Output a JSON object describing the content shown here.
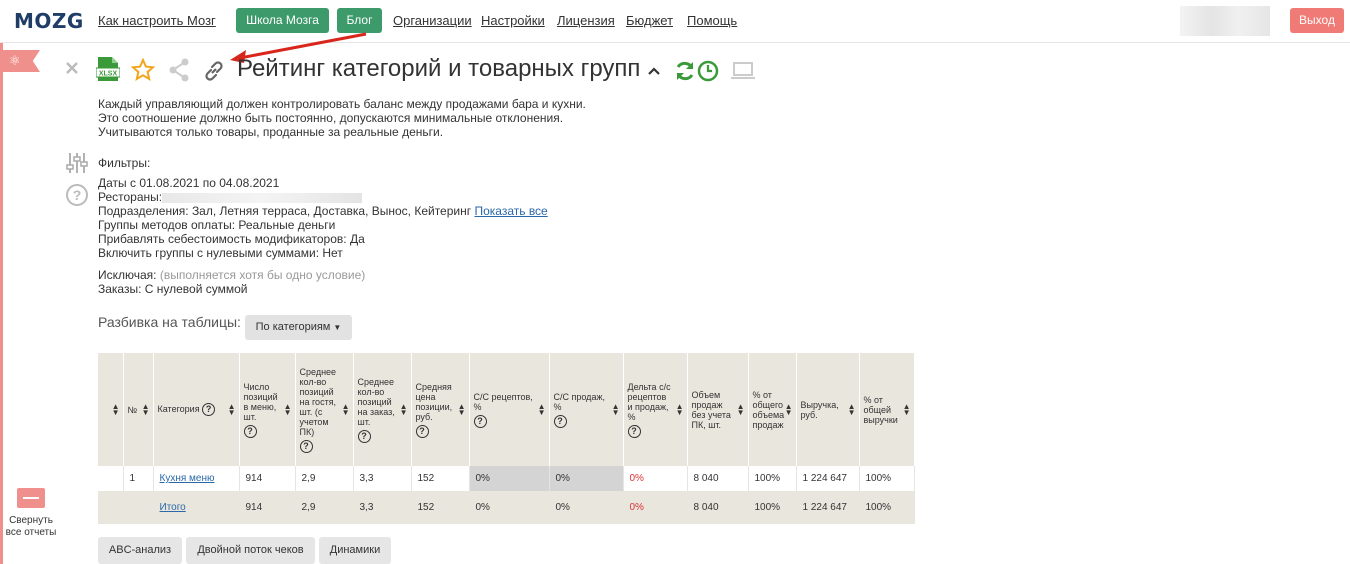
{
  "nav": {
    "logo": "MOZG",
    "how_to": "Как настроить Мозг",
    "school": "Школа Мозга",
    "blog": "Блог",
    "orgs": "Организации",
    "settings": "Настройки",
    "license": "Лицензия",
    "budget": "Бюджет",
    "help": "Помощь",
    "logout": "Выход"
  },
  "sidebar": {
    "collapse_label": "Свернуть все отчеты"
  },
  "report": {
    "title": "Рейтинг категорий и товарных групп",
    "description": [
      "Каждый управляющий должен контролировать баланс между продажами бара и кухни.",
      "Это соотношение должно быть постоянно, допускаются минимальные отклонения.",
      "Учитываются только товары, проданные за реальные деньги."
    ],
    "filters_title": "Фильтры:",
    "dates": "Даты с 01.08.2021 по 04.08.2021",
    "restaurants_label": "Рестораны:",
    "departments": "Подразделения: Зал, Летняя терраса, Доставка, Вынос, Кейтеринг",
    "show_all": "Показать все",
    "payment_groups": "Группы методов оплаты: Реальные деньги",
    "modifier_cost": "Прибавлять себестоимость модификаторов: Да",
    "zero_groups": "Включить группы с нулевыми суммами: Нет",
    "exclude_label": "Исключая:",
    "exclude_note": "(выполняется хотя бы одно условие)",
    "orders": "Заказы: С нулевой суммой",
    "split_label": "Разбивка на таблицы:",
    "split_value": "По категориям"
  },
  "table": {
    "headers": {
      "num": "№",
      "category": "Категория",
      "count": "Число позиций в меню, шт.",
      "avg_guest": "Среднее кол-во позиций на гостя, шт. (с учетом ПК)",
      "avg_order": "Среднее кол-во позиций на заказ, шт.",
      "avg_price": "Средняя цена позиции, руб.",
      "cost_recipe": "С/С рецептов, %",
      "cost_sales": "С/С продаж, %",
      "delta": "Дельта с/с рецептов и продаж, %",
      "volume": "Объем продаж без учета ПК, шт.",
      "share_volume": "% от общего объема продаж",
      "revenue": "Выручка, руб.",
      "share_revenue": "% от общей выручки"
    },
    "rows": [
      {
        "num": "1",
        "category": "Кухня меню",
        "count": "914",
        "avg_guest": "2,9",
        "avg_order": "3,3",
        "avg_price": "152",
        "cost_recipe": "0%",
        "cost_sales": "0%",
        "delta": "0%",
        "volume": "8 040",
        "share_volume": "100%",
        "revenue": "1 224 647",
        "share_revenue": "100%"
      }
    ],
    "total": {
      "category": "Итого",
      "count": "914",
      "avg_guest": "2,9",
      "avg_order": "3,3",
      "avg_price": "152",
      "cost_recipe": "0%",
      "cost_sales": "0%",
      "delta": "0%",
      "volume": "8 040",
      "share_volume": "100%",
      "revenue": "1 224 647",
      "share_revenue": "100%"
    }
  },
  "tabs": {
    "abc": "ABC-анализ",
    "double": "Двойной поток чеков",
    "dynamics": "Динамики"
  },
  "colors": {
    "green": "#3d9a6b",
    "logout": "#f07a75",
    "accent_red": "#e53935",
    "header_bg": "#e9e6de"
  }
}
